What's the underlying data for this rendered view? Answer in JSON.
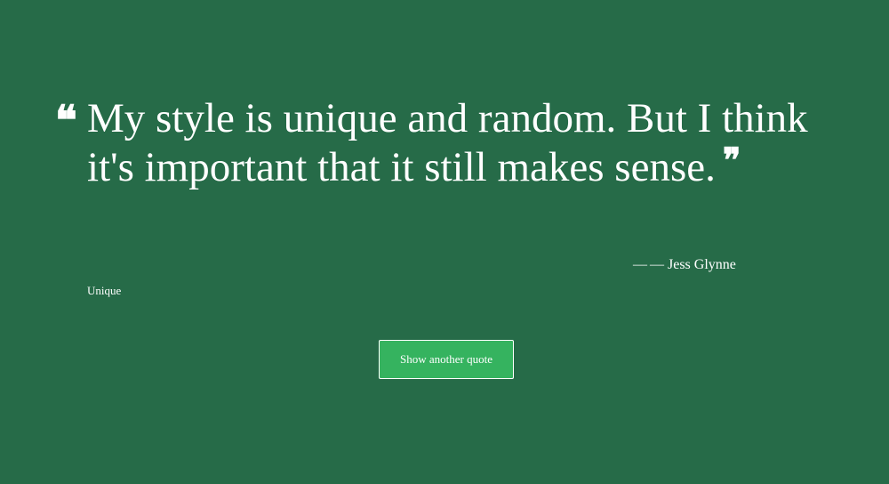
{
  "colors": {
    "background": "#266b48",
    "button_background": "#35b35f",
    "text": "#ffffff"
  },
  "quote": {
    "open_icon": "❝",
    "close_icon": "❞",
    "text": "My style is unique and random. But I think it's important that it still makes sense.",
    "author_dash": "—",
    "author": "— Jess Glynne",
    "tag": "Unique"
  },
  "actions": {
    "show_another_label": "Show another quote"
  }
}
